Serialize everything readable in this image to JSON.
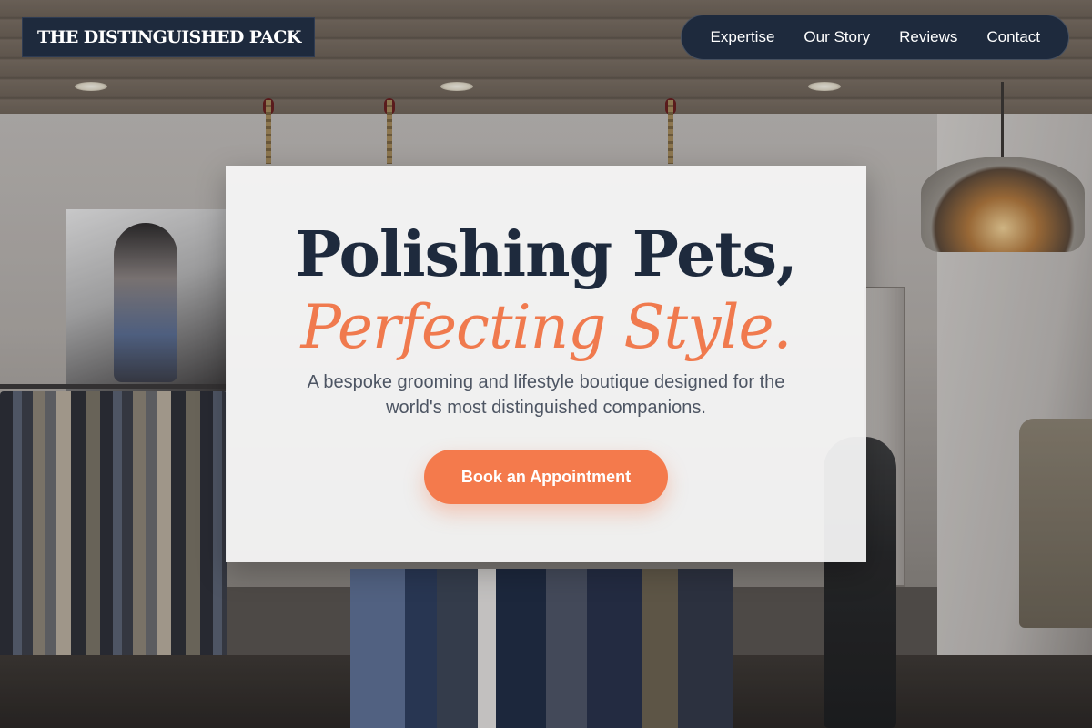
{
  "brand": {
    "logo_text": "THE DISTINGUISHED PACK"
  },
  "nav": {
    "items": [
      {
        "label": "Expertise"
      },
      {
        "label": "Our Story"
      },
      {
        "label": "Reviews"
      },
      {
        "label": "Contact"
      }
    ]
  },
  "hero": {
    "title_line1": "Polishing Pets,",
    "title_line2": "Perfecting Style.",
    "subtitle": "A bespoke grooming and lifestyle boutique designed for the world's most distinguished companions.",
    "cta_label": "Book an Appointment"
  },
  "colors": {
    "navy": "#1e2a3d",
    "accent": "#f47a4c",
    "card_background": "#f7f7f7",
    "subtitle_text": "#4d5563"
  }
}
